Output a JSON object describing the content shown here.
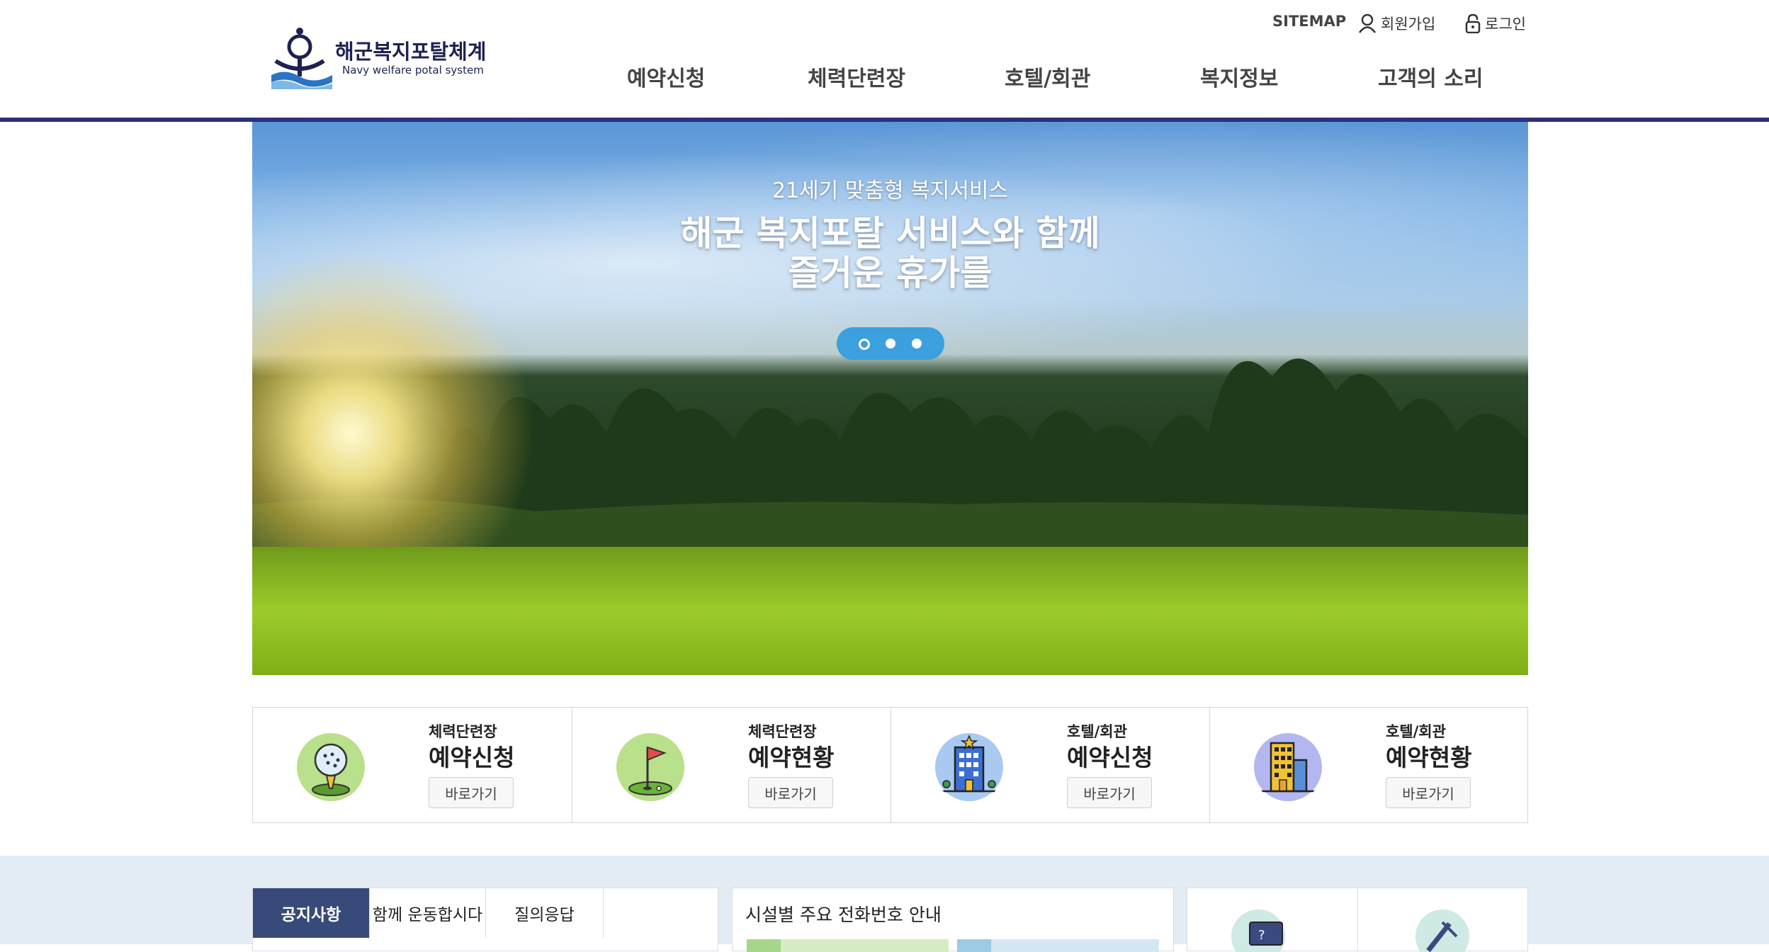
{
  "header": {
    "logo_title": "해군복지포탈체계",
    "logo_sub": "Navy welfare potal system",
    "util": {
      "sitemap": "SITEMAP",
      "join": "회원가입",
      "login": "로그인"
    },
    "nav": [
      "예약신청",
      "체력단련장",
      "호텔/회관",
      "복지정보",
      "고객의 소리"
    ]
  },
  "hero": {
    "subtitle": "21세기 맞춤형 복지서비스",
    "title_line1": "해군 복지포탈 서비스와 함께",
    "title_line2": "즐거운 휴가를",
    "slides": 3,
    "active_slide": 1
  },
  "quick_links": [
    {
      "category": "체력단련장",
      "title": "예약신청",
      "button": "바로가기",
      "icon": "golf-ball-icon"
    },
    {
      "category": "체력단련장",
      "title": "예약현황",
      "button": "바로가기",
      "icon": "golf-flag-icon"
    },
    {
      "category": "호텔/회관",
      "title": "예약신청",
      "button": "바로가기",
      "icon": "hotel-building-icon"
    },
    {
      "category": "호텔/회관",
      "title": "예약현황",
      "button": "바로가기",
      "icon": "hotel-tower-icon"
    }
  ],
  "board": {
    "tabs": [
      "공지사항",
      "함께 운동합시다",
      "질의응답"
    ],
    "active_tab": 0
  },
  "phone_panel": {
    "title": "시설별 주요 전화번호 안내"
  },
  "colors": {
    "brand": "#2d2f7c",
    "tab_active": "#374a7a",
    "pager": "#3ba0dd",
    "bottom_bg": "#e3ebf3"
  }
}
